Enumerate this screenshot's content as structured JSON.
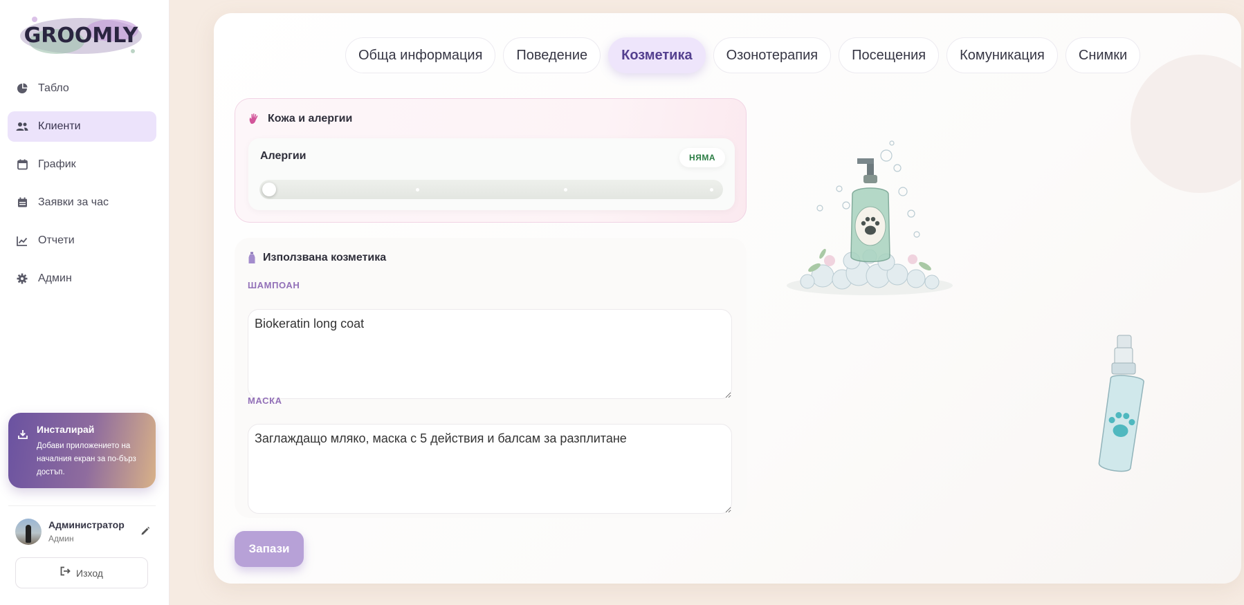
{
  "app": {
    "logo_text": "GROOMLY"
  },
  "sidebar": {
    "items": [
      {
        "label": "Табло",
        "icon": "pie-chart-icon"
      },
      {
        "label": "Клиенти",
        "icon": "users-icon",
        "active": true
      },
      {
        "label": "График",
        "icon": "calendar-icon"
      },
      {
        "label": "Заявки за час",
        "icon": "calendar-check-icon"
      },
      {
        "label": "Отчети",
        "icon": "line-chart-icon"
      },
      {
        "label": "Админ",
        "icon": "gear-icon"
      }
    ],
    "install": {
      "title": "Инсталирай",
      "description": "Добави приложението на началния екран за по-бърз достъп."
    },
    "user": {
      "name": "Администратор",
      "role": "Админ"
    },
    "logout_label": "Изход"
  },
  "tabs": [
    {
      "label": "Обща информация"
    },
    {
      "label": "Поведение"
    },
    {
      "label": "Козметика",
      "active": true
    },
    {
      "label": "Озонотерапия"
    },
    {
      "label": "Посещения"
    },
    {
      "label": "Комуникация"
    },
    {
      "label": "Снимки"
    }
  ],
  "skin": {
    "title": "Кожа и алергии",
    "allergy_label": "Алергии",
    "allergy_value": "НЯМА",
    "allergy_level": 0
  },
  "cosmetics": {
    "title": "Използвана козметика",
    "shampoo_label": "ШАМПОАН",
    "shampoo_value": "Biokeratin long coat",
    "mask_label": "МАСКА",
    "mask_value": "Заглаждащо мляко, маска с 5 действия и балсам за разплитане"
  },
  "save_label": "Запази",
  "colors": {
    "accent": "#b7a1d7",
    "active_tab_bg": "#eee5fb",
    "active_tab_text": "#54408f",
    "label_purple": "#9270b8",
    "badge_green": "#2a7c43"
  }
}
